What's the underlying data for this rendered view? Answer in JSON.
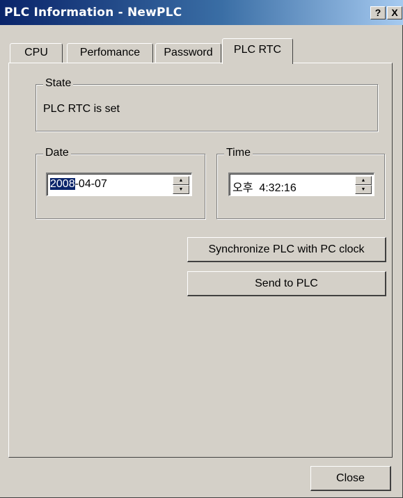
{
  "window": {
    "title": "PLC Information - NewPLC",
    "help_button": "?",
    "close_button": "X"
  },
  "tabs": [
    {
      "label": "CPU",
      "active": false
    },
    {
      "label": "Perfomance",
      "active": false
    },
    {
      "label": "Password",
      "active": false
    },
    {
      "label": "PLC RTC",
      "active": true
    }
  ],
  "state": {
    "group_label": "State",
    "text": "PLC RTC is set"
  },
  "date": {
    "group_label": "Date",
    "selected_part": "2008",
    "rest": "-04-07"
  },
  "time": {
    "group_label": "Time",
    "value": "오후  4:32:16"
  },
  "buttons": {
    "sync": "Synchronize PLC with PC clock",
    "send": "Send to PLC",
    "close": "Close"
  },
  "icons": {
    "spin_up": "spin-up-icon",
    "spin_down": "spin-down-icon"
  },
  "colors": {
    "title_gradient_start": "#0a246a",
    "title_gradient_end": "#a6caf0",
    "face": "#d4d0c8",
    "selection": "#0a246a"
  }
}
